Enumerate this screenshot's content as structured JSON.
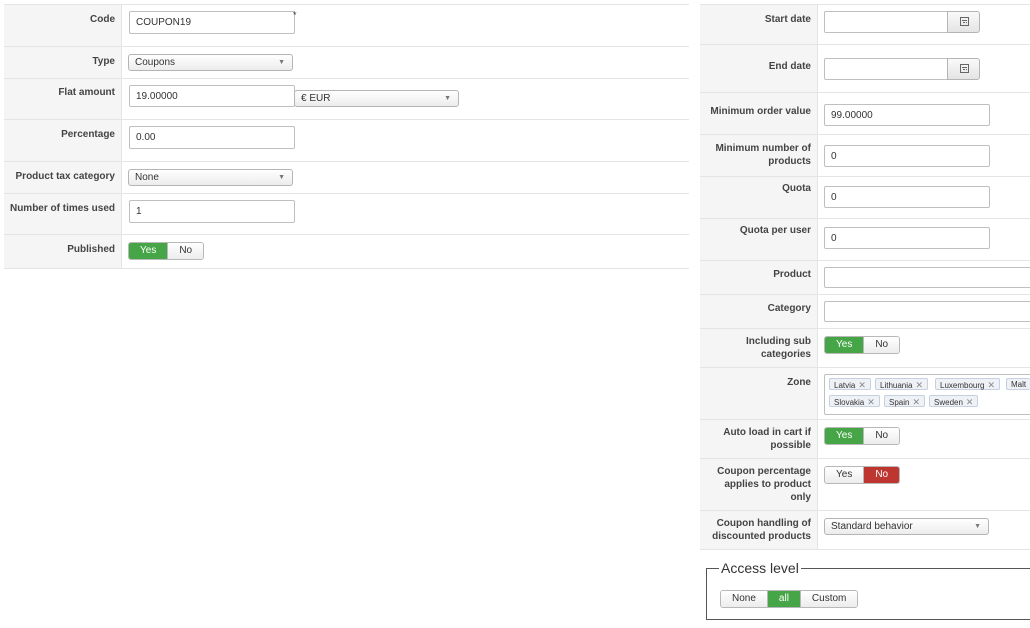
{
  "left": {
    "code": {
      "label": "Code",
      "value": "COUPON19",
      "required_mark": "*"
    },
    "type": {
      "label": "Type",
      "value": "Coupons"
    },
    "flat_amount": {
      "label": "Flat amount",
      "value": "19.00000",
      "currency": "€ EUR"
    },
    "percentage": {
      "label": "Percentage",
      "value": "0.00"
    },
    "product_tax_category": {
      "label": "Product tax category",
      "value": "None"
    },
    "times_used": {
      "label": "Number of times used",
      "value": "1"
    },
    "published": {
      "label": "Published",
      "yes": "Yes",
      "no": "No",
      "selected": "Yes"
    }
  },
  "right": {
    "start_date": {
      "label": "Start date",
      "value": ""
    },
    "end_date": {
      "label": "End date",
      "value": ""
    },
    "min_order": {
      "label": "Minimum order value",
      "value": "99.00000"
    },
    "min_products": {
      "label": "Minimum number of products",
      "value": "0"
    },
    "quota": {
      "label": "Quota",
      "value": "0"
    },
    "quota_per_user": {
      "label": "Quota per user",
      "value": "0"
    },
    "product": {
      "label": "Product",
      "value": ""
    },
    "category": {
      "label": "Category",
      "value": ""
    },
    "sub_categories": {
      "label": "Including sub categories",
      "yes": "Yes",
      "no": "No",
      "selected": "Yes"
    },
    "zone": {
      "label": "Zone",
      "tags": [
        "Latvia",
        "Lithuania",
        "Luxembourg",
        "Malt",
        "Slovakia",
        "Spain",
        "Sweden"
      ]
    },
    "auto_load": {
      "label": "Auto load in cart if possible",
      "yes": "Yes",
      "no": "No",
      "selected": "Yes"
    },
    "coupon_pct": {
      "label": "Coupon percentage applies to product only",
      "yes": "Yes",
      "no": "No",
      "selected": "No"
    },
    "coupon_handling": {
      "label": "Coupon handling of discounted products",
      "value": "Standard behavior"
    }
  },
  "access_level": {
    "legend": "Access level",
    "options": [
      "None",
      "all",
      "Custom"
    ],
    "selected": "all"
  },
  "colors": {
    "yes_green": "#46a546",
    "no_red": "#bd362f"
  }
}
